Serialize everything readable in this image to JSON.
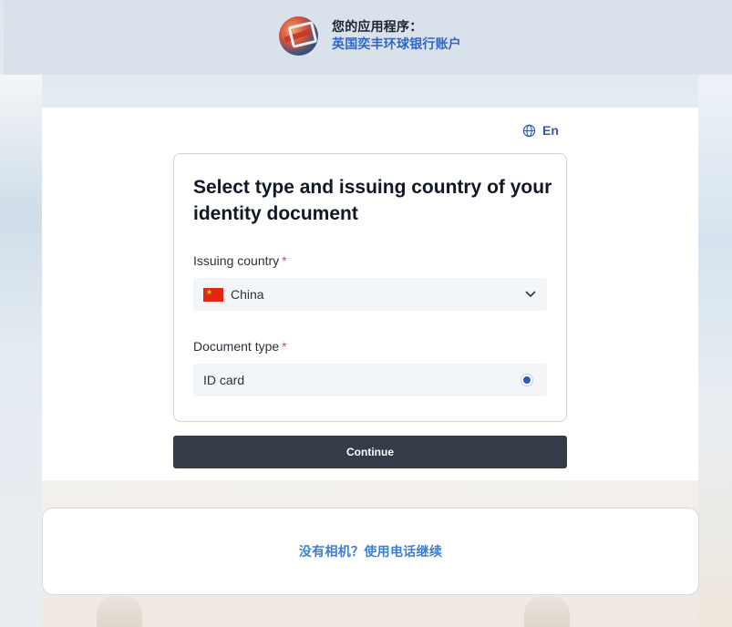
{
  "header": {
    "caption": "您的应用程序：",
    "app_name": "英国奕丰环球银行账户"
  },
  "language": {
    "label": "En"
  },
  "form": {
    "title": "Select type and issuing country of your identity document",
    "country_label": "Issuing country",
    "country_value": "China",
    "doc_type_label": "Document type",
    "doc_type_value": "ID card",
    "required_mark": "*"
  },
  "continue_label": "Continue",
  "phone_link": "没有相机？使用电话继续",
  "colors": {
    "accent": "#2f67c9",
    "button": "#343c48",
    "required": "#d84848",
    "link": "#3d7dd3"
  }
}
